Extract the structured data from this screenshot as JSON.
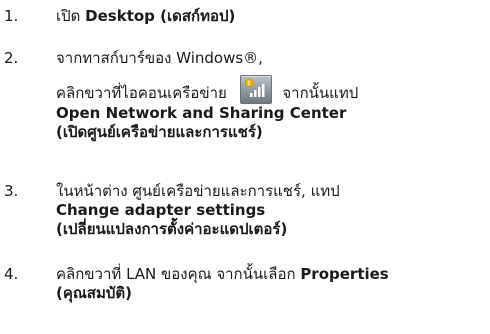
{
  "steps": [
    {
      "number": "1.",
      "text_before": "เปิด ",
      "bold": "Desktop (เดสก์ทอป)"
    },
    {
      "number": "2.",
      "line1": "จากทาสก์บาร์ของ Windows®,",
      "line2_before": "คลิกขวาที่ไอคอนเครือข่าย ",
      "line2_after": " จากนั้นแทป",
      "bold_line1": "Open Network and Sharing Center",
      "bold_line2": "(เปิดศูนย์เครือข่ายและการแชร์)",
      "icon": "network-icon"
    },
    {
      "number": "3.",
      "line1": "ในหน้าต่าง ศูนย์เครือข่ายและการแชร์, แทป",
      "bold_line1": "Change adapter settings",
      "bold_line2": "(เปลี่ยนแปลงการตั้งค่าอะแดปเตอร์)"
    },
    {
      "number": "4.",
      "text_before": "คลิกขวาที่ LAN ของคุณ จากนั้นเลือก ",
      "bold_inline": "Properties",
      "bold_line2": "(คุณสมบัติ)"
    }
  ]
}
